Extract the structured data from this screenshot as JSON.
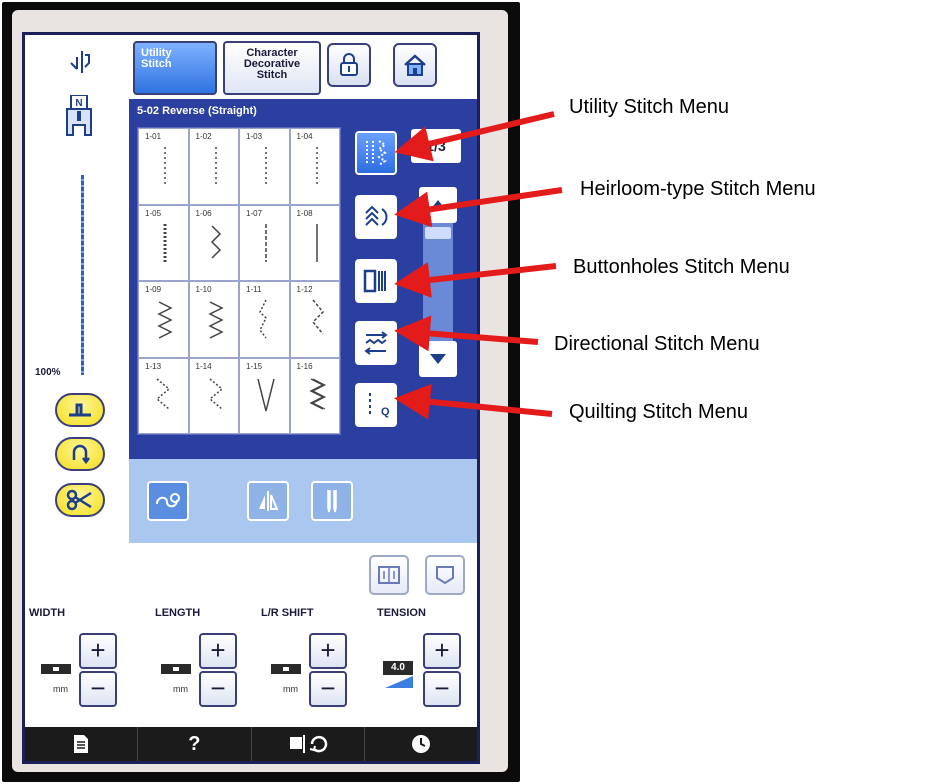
{
  "tabs": {
    "utility": [
      "Utility",
      "Stitch"
    ],
    "character": [
      "Character",
      "Decorative",
      "Stitch"
    ]
  },
  "left": {
    "zoom": "100%"
  },
  "panel": {
    "header": "5-02  Reverse (Straight)",
    "page": "1/3",
    "stitches": [
      "1-01",
      "1-02",
      "1-03",
      "1-04",
      "1-05",
      "1-06",
      "1-07",
      "1-08",
      "1-09",
      "1-10",
      "1-11",
      "1-12",
      "1-13",
      "1-14",
      "1-15",
      "1-16"
    ]
  },
  "params": {
    "width_label": "WIDTH",
    "length_label": "LENGTH",
    "shift_label": "L/R SHIFT",
    "tension_label": "TENSION",
    "unit": "mm",
    "tension_value": "4.0"
  },
  "bottom": {
    "help": "?"
  },
  "callouts": {
    "utility": "Utility Stitch Menu",
    "heirloom": "Heirloom-type Stitch Menu",
    "buttonholes": "Buttonholes Stitch Menu",
    "directional": "Directional Stitch Menu",
    "quilting": "Quilting Stitch Menu"
  },
  "colors": {
    "arrow": "#e31b1b",
    "panel": "#2a3fa0",
    "accent": "#2c6ee0",
    "yellow": "#f3df1a"
  }
}
